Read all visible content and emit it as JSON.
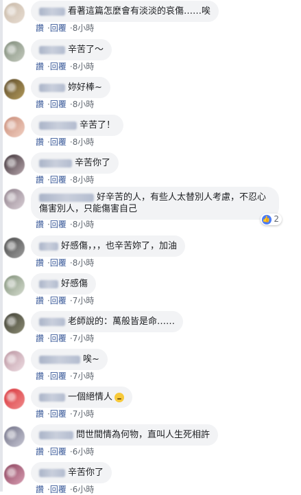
{
  "comments": [
    {
      "text": "看著這篇怎麼會有淡淡的哀傷……唉",
      "like": "讚",
      "reply": "回覆",
      "time": "8小時"
    },
    {
      "text": "辛苦了～",
      "like": "讚",
      "reply": "回覆",
      "time": "8小時"
    },
    {
      "text": "妳好棒~",
      "like": "讚",
      "reply": "回覆",
      "time": "8小時"
    },
    {
      "text": "辛苦了！",
      "like": "讚",
      "reply": "回覆",
      "time": "8小時"
    },
    {
      "text": "辛苦你了",
      "like": "讚",
      "reply": "回覆",
      "time": "8小時"
    },
    {
      "text": "好辛苦的人，有些人太替別人考慮，不忍心傷害別人，只能傷害自己",
      "like": "讚",
      "reply": "回覆",
      "time": "8小時",
      "reaction_count": "2"
    },
    {
      "text": "好感傷，，，也辛苦妳了，加油",
      "like": "讚",
      "reply": "回覆",
      "time": "8小時"
    },
    {
      "text": "好感傷",
      "like": "讚",
      "reply": "回覆",
      "time": "7小時"
    },
    {
      "text": "老師說的：萬般皆是命……",
      "like": "讚",
      "reply": "回覆",
      "time": "7小時"
    },
    {
      "text": "唉~",
      "like": "讚",
      "reply": "回覆",
      "time": "7小時"
    },
    {
      "text": "一個絕情人",
      "like": "讚",
      "reply": "回覆",
      "time": "7小時",
      "emoji": "crying-face-icon"
    },
    {
      "text": "問世間情為何物，直叫人生死相許",
      "like": "讚",
      "reply": "回覆",
      "time": "6小時"
    },
    {
      "text": "辛苦你了",
      "like": "讚",
      "reply": "回覆",
      "time": "6小時"
    }
  ]
}
